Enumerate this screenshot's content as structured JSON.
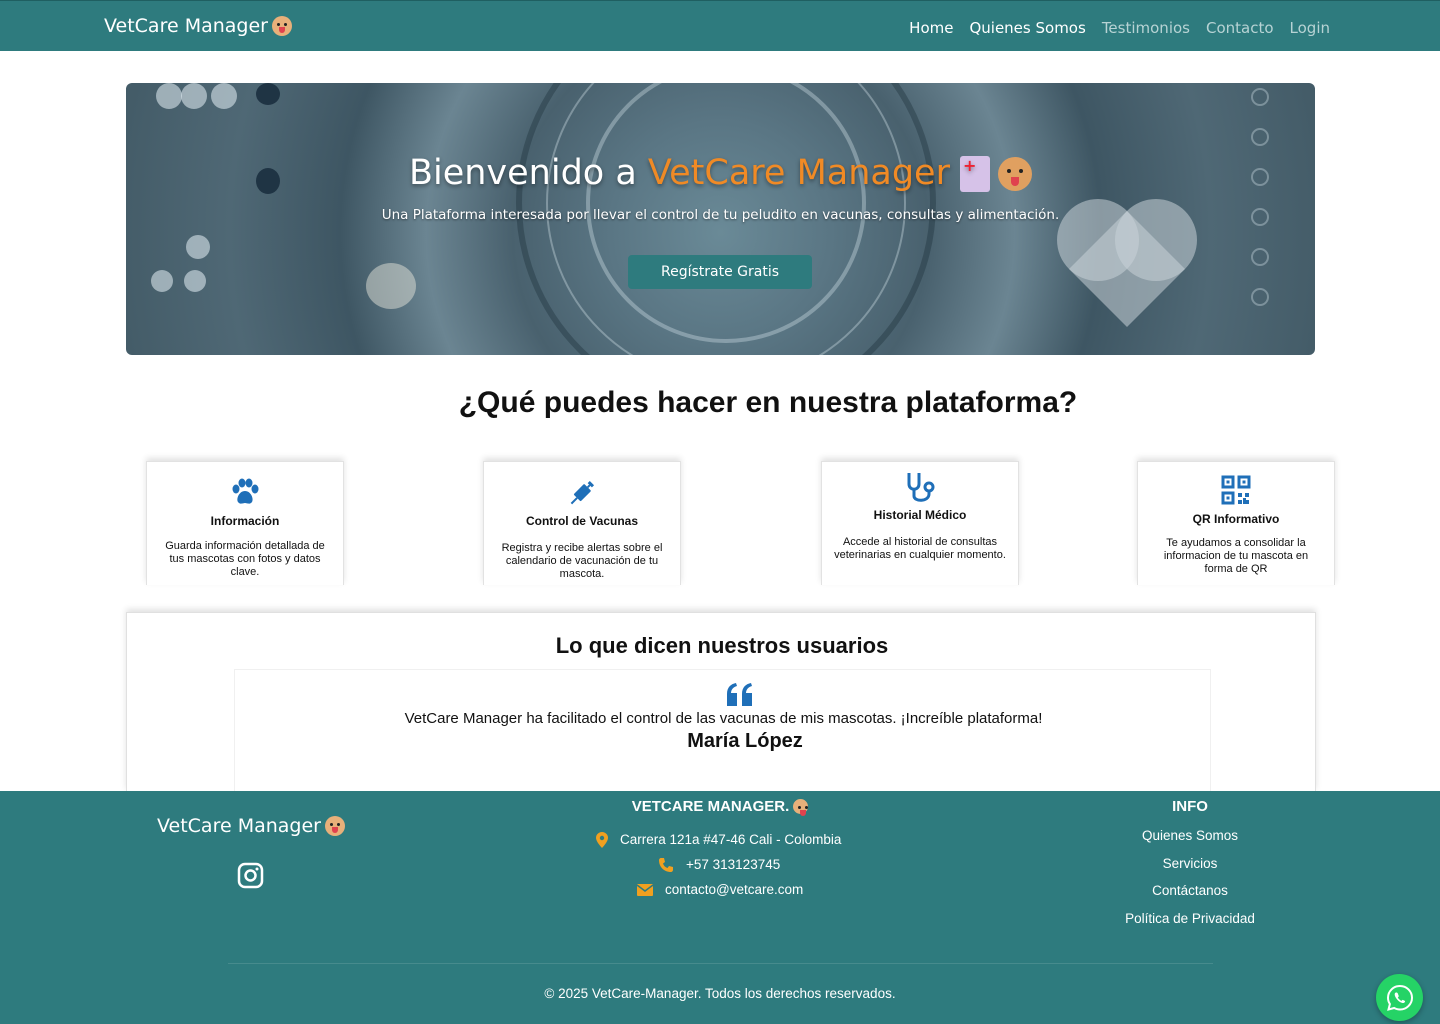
{
  "navbar": {
    "brand": "VetCare Manager",
    "links": [
      {
        "label": "Home"
      },
      {
        "label": "Quienes Somos"
      },
      {
        "label": "Testimonios"
      },
      {
        "label": "Contacto"
      },
      {
        "label": "Login"
      }
    ]
  },
  "hero": {
    "title_prefix": "Bienvenido a ",
    "title_accent": "VetCare Manager",
    "subtitle": "Una Plataforma interesada por llevar el control de tu peludito en vacunas, consultas y alimentación.",
    "cta": "Regístrate Gratis"
  },
  "features": {
    "title": "¿Qué puedes hacer en nuestra plataforma?",
    "items": [
      {
        "title": "Información",
        "desc": "Guarda información detallada de tus mascotas con fotos y datos clave.",
        "icon": "paw-icon"
      },
      {
        "title": "Control de Vacunas",
        "desc": "Registra y recibe alertas sobre el calendario de vacunación de tu mascota.",
        "icon": "syringe-icon"
      },
      {
        "title": "Historial Médico",
        "desc": "Accede al historial de consultas veterinarias en cualquier momento.",
        "icon": "stethoscope-icon"
      },
      {
        "title": "QR Informativo",
        "desc": "Te ayudamos a consolidar la informacion de tu mascota en forma de QR",
        "icon": "qr-code-icon"
      }
    ]
  },
  "testimonials": {
    "title": "Lo que dicen nuestros usuarios",
    "text": "VetCare Manager ha facilitado el control de las vacunas de mis mascotas. ¡Increíble plataforma!",
    "author": "María López"
  },
  "footer": {
    "brand": "VetCare Manager",
    "contact_title": "VETCARE MANAGER.",
    "address": "Carrera 121a #47-46 Cali - Colombia",
    "phone": "+57 313123745",
    "email": "contacto@vetcare.com",
    "info_title": "INFO",
    "info_links": [
      {
        "label": "Quienes Somos"
      },
      {
        "label": "Servicios"
      },
      {
        "label": "Contáctanos"
      },
      {
        "label": "Política de Privacidad"
      }
    ],
    "copyright": "© 2025 VetCare-Manager. Todos los derechos reservados."
  },
  "colors": {
    "primary": "#2e7b7e",
    "accent": "#f08a25",
    "icon_blue": "#1f6fb8",
    "whatsapp": "#25d366"
  }
}
